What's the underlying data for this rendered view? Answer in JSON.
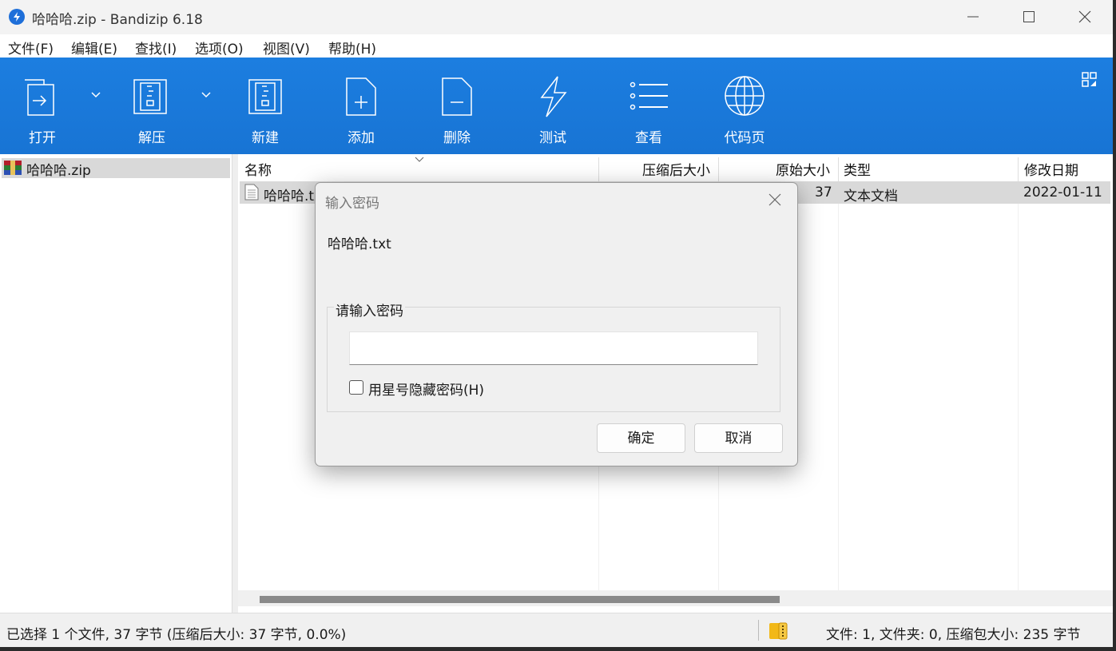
{
  "window": {
    "title": "哈哈哈.zip - Bandizip 6.18"
  },
  "menu": [
    "文件(F)",
    "编辑(E)",
    "查找(I)",
    "选项(O)",
    "视图(V)",
    "帮助(H)"
  ],
  "toolbar": {
    "buttons": [
      {
        "label": "打开",
        "icon": "open-icon"
      },
      {
        "label": "解压",
        "icon": "extract-icon"
      },
      {
        "label": "新建",
        "icon": "new-archive-icon"
      },
      {
        "label": "添加",
        "icon": "add-icon"
      },
      {
        "label": "删除",
        "icon": "delete-icon"
      },
      {
        "label": "测试",
        "icon": "test-icon"
      },
      {
        "label": "查看",
        "icon": "view-icon"
      },
      {
        "label": "代码页",
        "icon": "codepage-icon"
      }
    ]
  },
  "tree": {
    "items": [
      {
        "label": "哈哈哈.zip",
        "icon": "zip-archive-icon"
      }
    ]
  },
  "list": {
    "columns": [
      "名称",
      "压缩后大小",
      "原始大小",
      "类型",
      "修改日期"
    ],
    "rows": [
      {
        "name": "哈哈哈.txt",
        "compressed": "",
        "original": "37",
        "type": "文本文档",
        "modified": "2022-01-11"
      }
    ]
  },
  "status": {
    "left": "已选择 1 个文件, 37 字节 (压缩后大小: 37 字节, 0.0%)",
    "right": "文件: 1, 文件夹: 0, 压缩包大小: 235 字节"
  },
  "dialog": {
    "title": "输入密码",
    "filename": "哈哈哈.txt",
    "group_label": "请输入密码",
    "password_value": "",
    "mask_checkbox_label": "用星号隐藏密码(H)",
    "mask_checked": false,
    "ok": "确定",
    "cancel": "取消"
  },
  "colors": {
    "toolbar": "#1874d4",
    "selection": "#d9d9d9",
    "dialog_bg": "#f0f0f0"
  }
}
